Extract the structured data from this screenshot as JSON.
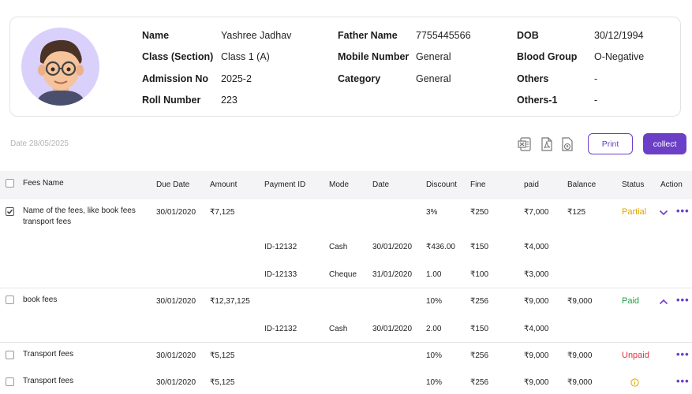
{
  "student": {
    "name_label": "Name",
    "name": "Yashree Jadhav",
    "class_label": "Class (Section)",
    "class": "Class 1 (A)",
    "admission_label": "Admission No",
    "admission": "2025-2",
    "roll_label": "Roll Number",
    "roll": "223",
    "father_label": "Father Name",
    "father": "7755445566",
    "mobile_label": "Mobile Number",
    "mobile": "General",
    "category_label": "Category",
    "category": "General",
    "dob_label": "DOB",
    "dob": "30/12/1994",
    "blood_label": "Blood Group",
    "blood": "O-Negative",
    "others_label": "Others",
    "others": "-",
    "others1_label": "Others-1",
    "others1": "-"
  },
  "toolbar": {
    "date": "Date 28/05/2025",
    "print_label": "Print",
    "collect_label": "collect",
    "icons": [
      "excel-icon",
      "pdf-icon",
      "upload-file-icon"
    ]
  },
  "table": {
    "headers": {
      "fees_name": "Fees Name",
      "due_date": "Due Date",
      "amount": "Amount",
      "payment_id": "Payment ID",
      "mode": "Mode",
      "date": "Date",
      "discount": "Discount",
      "fine": "Fine",
      "paid": "paid",
      "balance": "Balance",
      "status": "Status",
      "action": "Action"
    },
    "rows": [
      {
        "name_line1": "Name of the fees, like book fees",
        "name_line2": "transport fees",
        "due": "30/01/2020",
        "amount": "₹7,125",
        "discount": "3%",
        "fine": "₹250",
        "paid": "₹7,000",
        "balance": "₹125",
        "status": "Partial",
        "checked": true
      },
      {
        "payment_id": "ID-12132",
        "mode": "Cash",
        "date": "30/01/2020",
        "discount": "₹436.00",
        "fine": "₹150",
        "paid": "₹4,000"
      },
      {
        "payment_id": "ID-12133",
        "mode": "Cheque",
        "date": "31/01/2020",
        "discount": "1.00",
        "fine": "₹100",
        "paid": "₹3,000"
      },
      {
        "name_line1": "book fees",
        "due": "30/01/2020",
        "amount": "₹12,37,125",
        "discount": "10%",
        "fine": "₹256",
        "paid": "₹9,000",
        "balance": "₹9,000",
        "status": "Paid"
      },
      {
        "payment_id": "ID-12132",
        "mode": "Cash",
        "date": "30/01/2020",
        "discount": "2.00",
        "fine": "₹150",
        "paid": "₹4,000"
      },
      {
        "name_line1": "Transport fees",
        "due": "30/01/2020",
        "amount": "₹5,125",
        "discount": "10%",
        "fine": "₹256",
        "paid": "₹9,000",
        "balance": "₹9,000",
        "status": "Unpaid"
      },
      {
        "name_line1": "Transport fees",
        "due": "30/01/2020",
        "amount": "₹5,125",
        "discount": "10%",
        "fine": "₹256",
        "paid": "₹9,000",
        "balance": "₹9,000",
        "status_icon": "info-icon"
      }
    ]
  },
  "colors": {
    "accent": "#6c3fc7",
    "partial": "#e0a400",
    "paid": "#22a045",
    "unpaid": "#e0313d",
    "header_bg": "#f4f4f6"
  }
}
